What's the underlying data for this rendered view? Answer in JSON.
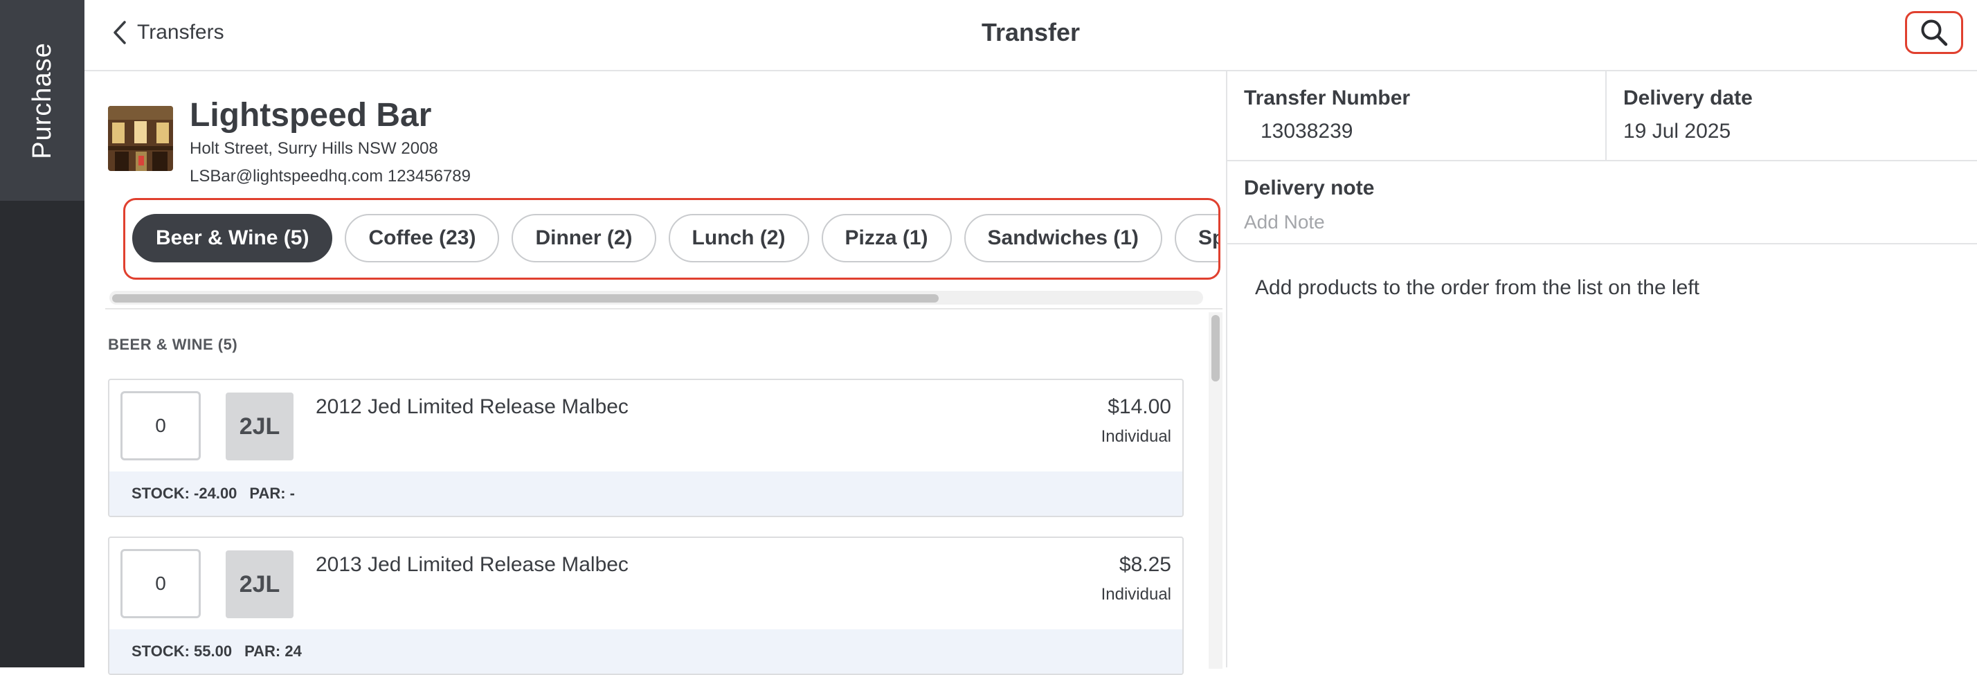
{
  "sidebar": {
    "tab_label": "Purchase"
  },
  "header": {
    "back_label": "Transfers",
    "title": "Transfer",
    "search_icon": "search-icon"
  },
  "venue": {
    "name": "Lightspeed Bar",
    "address": "Holt Street, Surry Hills NSW 2008",
    "contact": "LSBar@lightspeedhq.com 123456789"
  },
  "categories": [
    {
      "label": "Beer & Wine (5)",
      "active": true
    },
    {
      "label": "Coffee (23)",
      "active": false
    },
    {
      "label": "Dinner (2)",
      "active": false
    },
    {
      "label": "Lunch (2)",
      "active": false
    },
    {
      "label": "Pizza (1)",
      "active": false
    },
    {
      "label": "Sandwiches (1)",
      "active": false
    },
    {
      "label": "Spirits",
      "active": false
    }
  ],
  "product_list": {
    "section_header": "BEER & WINE (5)",
    "items": [
      {
        "qty": "0",
        "thumb": "2JL",
        "name": "2012 Jed Limited Release Malbec",
        "price": "$14.00",
        "unit": "Individual",
        "stock_label": "STOCK: -24.00",
        "par_label": "PAR: -"
      },
      {
        "qty": "0",
        "thumb": "2JL",
        "name": "2013 Jed Limited Release Malbec",
        "price": "$8.25",
        "unit": "Individual",
        "stock_label": "STOCK: 55.00",
        "par_label": "PAR: 24"
      }
    ]
  },
  "transfer": {
    "number_label": "Transfer Number",
    "number_value": "13038239",
    "date_label": "Delivery date",
    "date_value": "19 Jul 2025",
    "note_label": "Delivery note",
    "note_placeholder": "Add Note",
    "empty_message": "Add products to the order from the list on the left"
  },
  "colors": {
    "rail_bg": "#2a2c30",
    "rail_tab_bg": "#3d4046",
    "highlight": "#e0402f",
    "active_chip": "#3d4046",
    "stock_bar_bg": "#eff3fa"
  }
}
